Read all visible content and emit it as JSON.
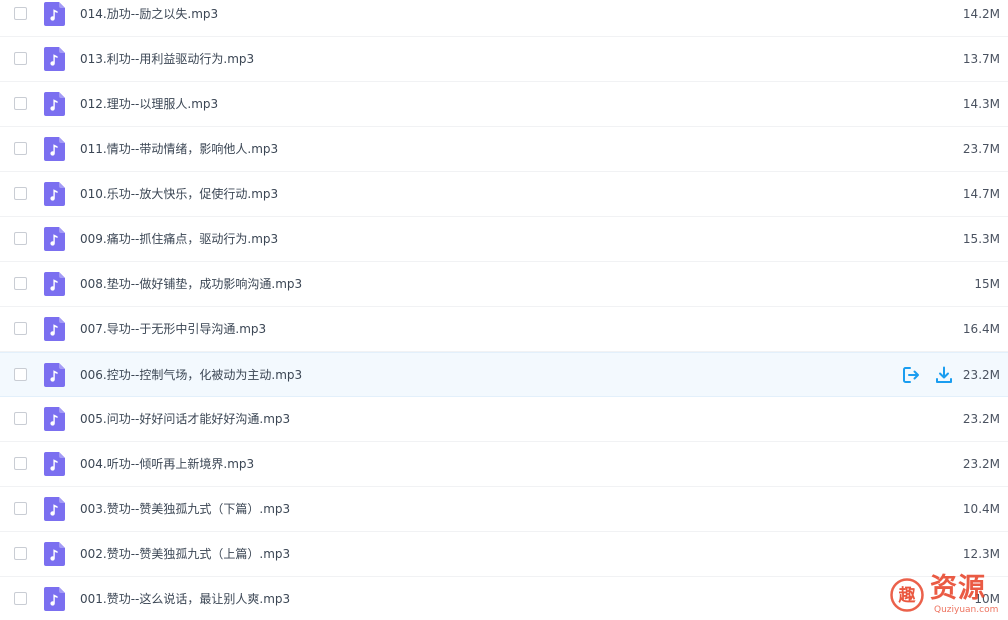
{
  "file_list": {
    "accent_color": "#1a9df0",
    "icon_color": "#7b6ff0",
    "rows": [
      {
        "name": "014.劢功--励之以失.mp3",
        "size": "14.2M",
        "hovered": false
      },
      {
        "name": "013.利功--用利益驱动行为.mp3",
        "size": "13.7M",
        "hovered": false
      },
      {
        "name": "012.理功--以理服人.mp3",
        "size": "14.3M",
        "hovered": false
      },
      {
        "name": "011.情功--带动情绪，影响他人.mp3",
        "size": "23.7M",
        "hovered": false
      },
      {
        "name": "010.乐功--放大快乐，促使行动.mp3",
        "size": "14.7M",
        "hovered": false
      },
      {
        "name": "009.痛功--抓住痛点，驱动行为.mp3",
        "size": "15.3M",
        "hovered": false
      },
      {
        "name": "008.垫功--做好铺垫，成功影响沟通.mp3",
        "size": "15M",
        "hovered": false
      },
      {
        "name": "007.导功--于无形中引导沟通.mp3",
        "size": "16.4M",
        "hovered": false
      },
      {
        "name": "006.控功--控制气场，化被动为主动.mp3",
        "size": "23.2M",
        "hovered": true
      },
      {
        "name": "005.问功--好好问话才能好好沟通.mp3",
        "size": "23.2M",
        "hovered": false
      },
      {
        "name": "004.听功--倾听再上新境界.mp3",
        "size": "23.2M",
        "hovered": false
      },
      {
        "name": "003.赞功--赞美独孤九式（下篇）.mp3",
        "size": "10.4M",
        "hovered": false
      },
      {
        "name": "002.赞功--赞美独孤九式（上篇）.mp3",
        "size": "12.3M",
        "hovered": false
      },
      {
        "name": "001.赞功--这么说话，最让别人爽.mp3",
        "size": "10M",
        "hovered": false
      }
    ]
  },
  "row_icons": {
    "file": "music-note-icon",
    "share": "share-icon",
    "download": "download-icon"
  },
  "watermark": {
    "badge_char": "趣",
    "title": "资源",
    "url": "Quziyuan.com"
  }
}
